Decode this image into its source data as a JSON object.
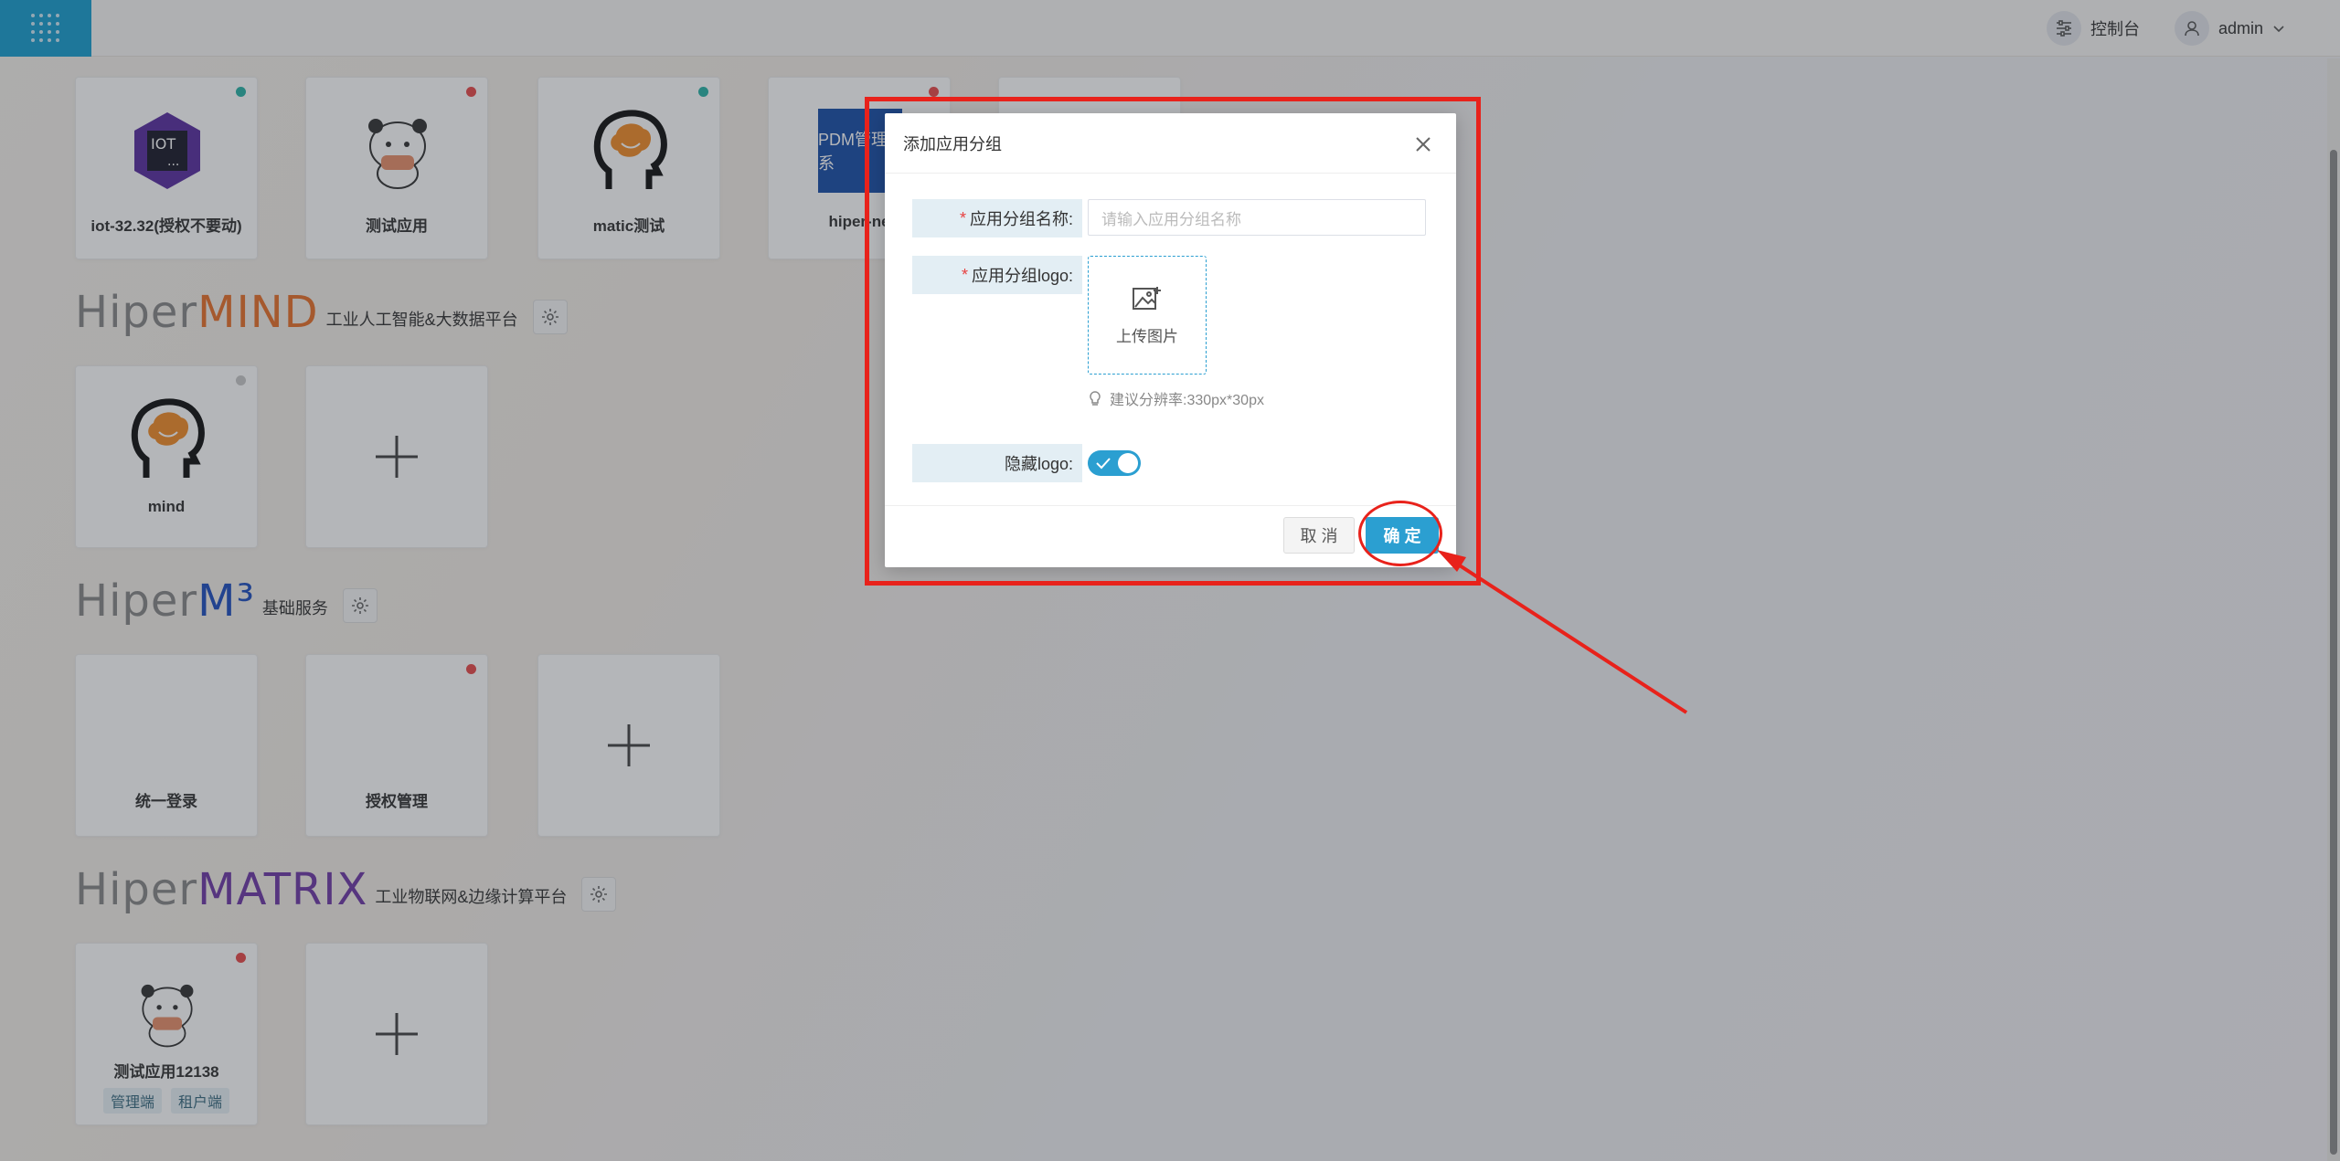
{
  "topbar": {
    "console_label": "控制台",
    "user_label": "admin"
  },
  "top_cards": [
    {
      "name": "iot-32.32(授权不要动)",
      "dot": "#2ab3a6"
    },
    {
      "name": "测试应用",
      "dot": "#e84b4b"
    },
    {
      "name": "matic测试",
      "dot": "#2ab3a6"
    },
    {
      "name": "hiper-ne",
      "dot": "#e84b4b",
      "logo_text": "PDM管理系"
    }
  ],
  "sections": [
    {
      "brand_gray": "Hiper",
      "brand_color": "MIND",
      "brand_color_hex": "#e8702a",
      "subtitle": "工业人工智能&大数据平台",
      "cards": [
        {
          "name": "mind",
          "dot": "#c8c8c8"
        }
      ]
    },
    {
      "brand_gray": "Hiper",
      "brand_color": "M³",
      "brand_color_hex": "#1f4fbf",
      "subtitle": "基础服务",
      "cards": [
        {
          "name": "统一登录",
          "dot": ""
        },
        {
          "name": "授权管理",
          "dot": "#e84b4b"
        }
      ]
    },
    {
      "brand_gray": "Hiper",
      "brand_color": "MATRIX",
      "brand_color_hex": "#6f3aa6",
      "subtitle": "工业物联网&边缘计算平台",
      "cards": [
        {
          "name": "测试应用12138",
          "dot": "#e84b4b",
          "tags": [
            "管理端",
            "租户端"
          ]
        }
      ]
    }
  ],
  "modal": {
    "title": "添加应用分组",
    "name_label": "应用分组名称:",
    "name_placeholder": "请输入应用分组名称",
    "logo_label": "应用分组logo:",
    "upload_text": "上传图片",
    "hint": "建议分辨率:330px*30px",
    "hide_logo_label": "隐藏logo:",
    "hide_logo_on": true,
    "cancel": "取 消",
    "ok": "确 定"
  },
  "colors": {
    "accent": "#2b9fd1",
    "annotation": "#e8221b"
  }
}
